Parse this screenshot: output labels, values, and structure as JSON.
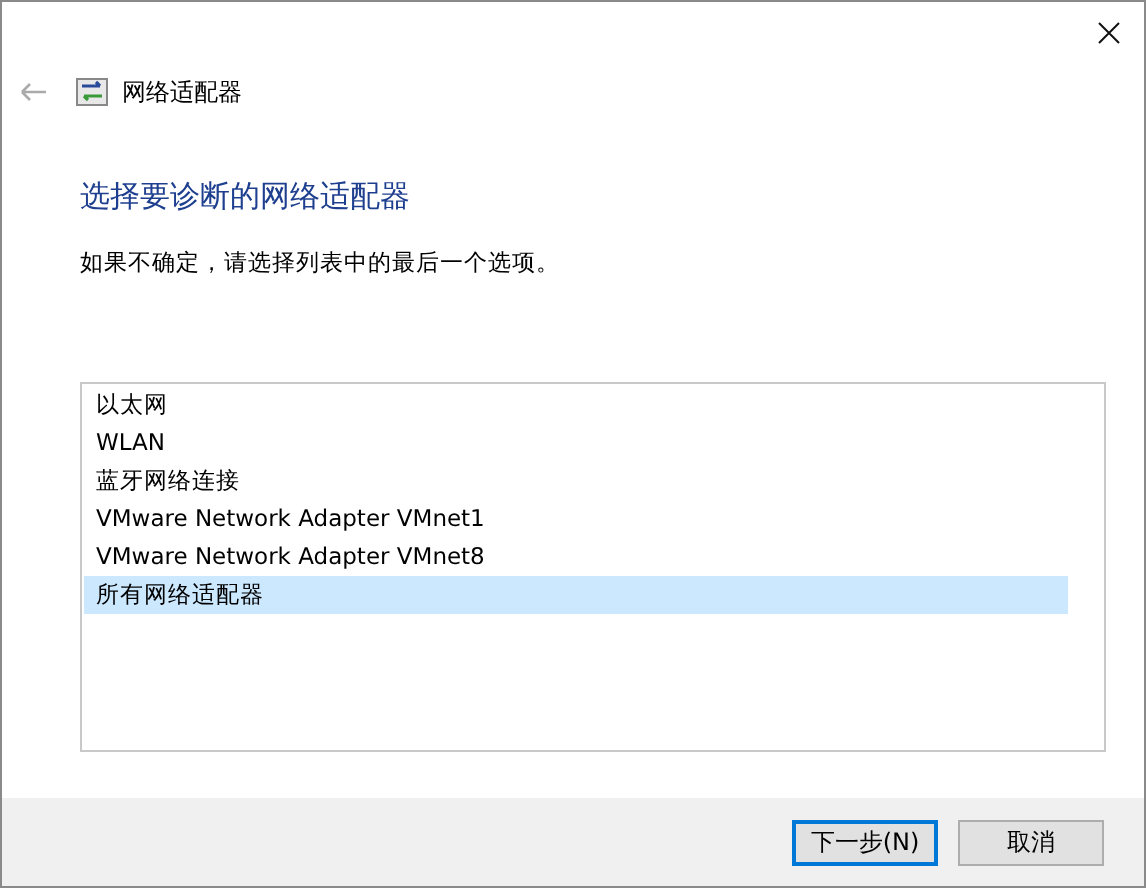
{
  "window": {
    "title": "网络适配器"
  },
  "heading": "选择要诊断的网络适配器",
  "instruction": "如果不确定，请选择列表中的最后一个选项。",
  "adapters": [
    {
      "label": "以太网",
      "selected": false
    },
    {
      "label": "WLAN",
      "selected": false
    },
    {
      "label": "蓝牙网络连接",
      "selected": false
    },
    {
      "label": "VMware Network Adapter VMnet1",
      "selected": false
    },
    {
      "label": "VMware Network Adapter VMnet8",
      "selected": false
    },
    {
      "label": "所有网络适配器",
      "selected": true
    }
  ],
  "buttons": [
    {
      "label": "下一步(N)",
      "kind": "default"
    },
    {
      "label": "取消",
      "kind": "normal"
    }
  ]
}
